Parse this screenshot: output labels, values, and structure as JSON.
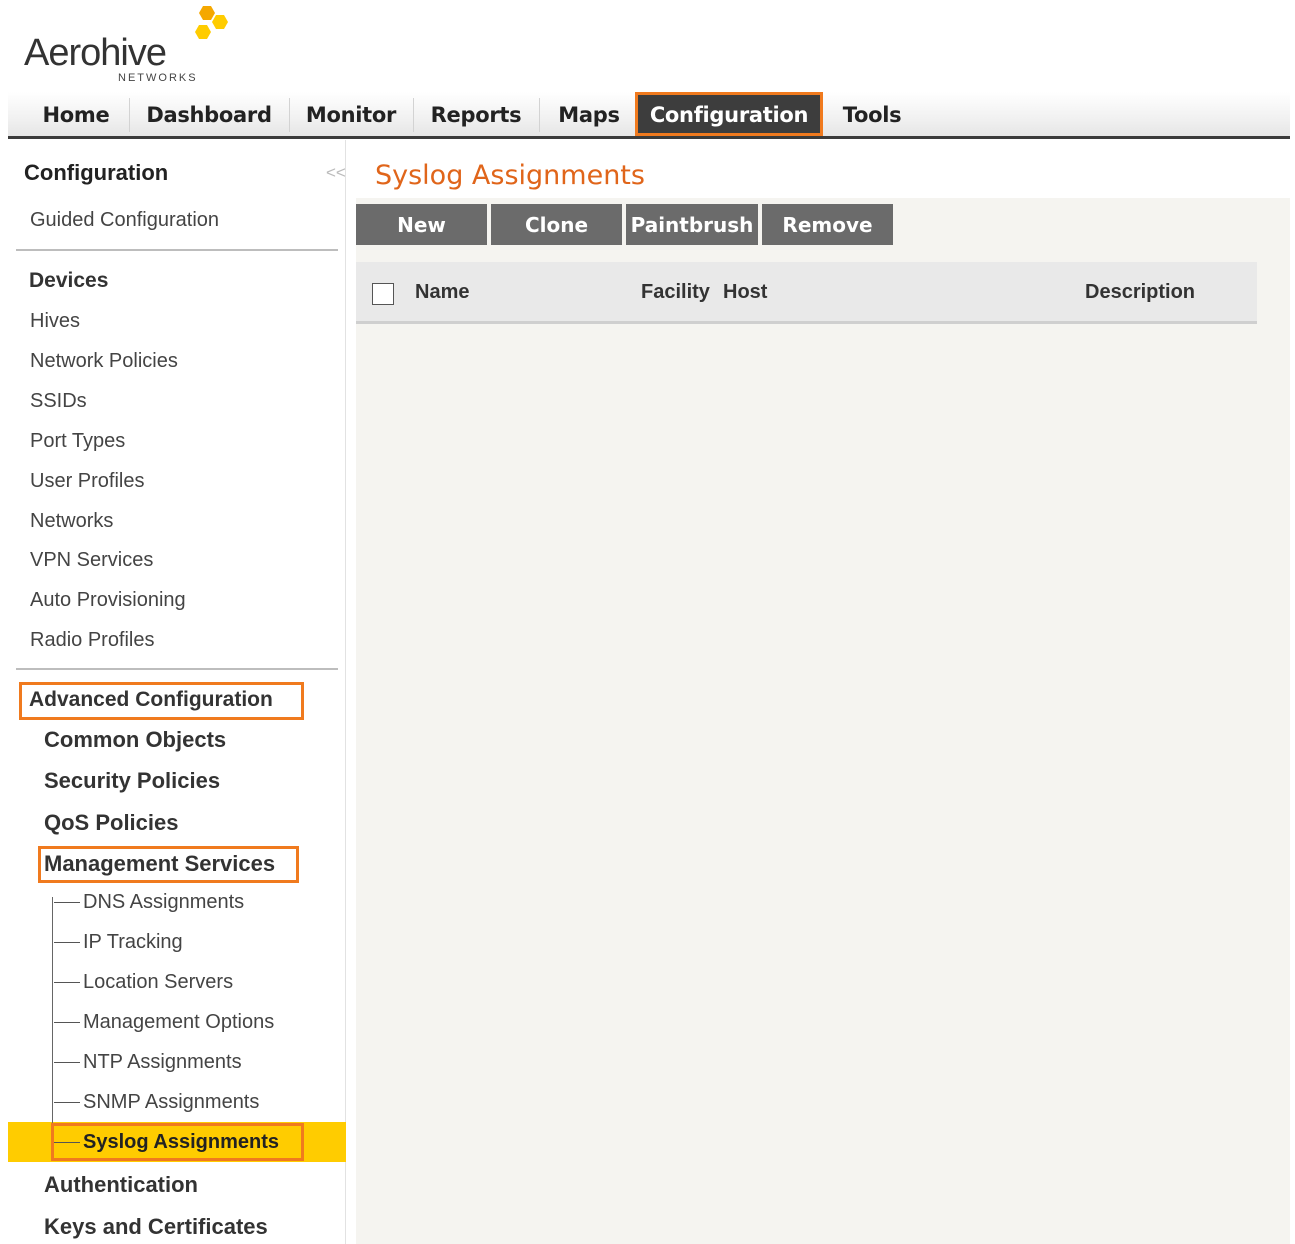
{
  "logo": {
    "wordmark": "Aerohive",
    "subtext": "NETWORKS",
    "colors": [
      "#f5a800",
      "#ffcc00"
    ]
  },
  "topnav": {
    "items": [
      "Home",
      "Dashboard",
      "Monitor",
      "Reports",
      "Maps",
      "Configuration",
      "Tools"
    ],
    "active": "Configuration"
  },
  "sidebar": {
    "title": "Configuration",
    "collapse_glyph": "<<",
    "guided": "Guided Configuration",
    "devices_heading": "Devices",
    "device_links": [
      "Hives",
      "Network Policies",
      "SSIDs",
      "Port Types",
      "User Profiles",
      "Networks",
      "VPN Services",
      "Auto Provisioning",
      "Radio Profiles"
    ],
    "advanced_heading": "Advanced Configuration",
    "advanced_sections": [
      "Common Objects",
      "Security Policies",
      "QoS Policies",
      "Management Services"
    ],
    "management_items": [
      "DNS Assignments",
      "IP Tracking",
      "Location Servers",
      "Management Options",
      "NTP Assignments",
      "SNMP Assignments",
      "Syslog Assignments"
    ],
    "selected": "Syslog Assignments",
    "after_sections": [
      "Authentication",
      "Keys and Certificates"
    ]
  },
  "main": {
    "title": "Syslog Assignments",
    "buttons": [
      "New",
      "Clone",
      "Paintbrush",
      "Remove"
    ],
    "columns": [
      "Name",
      "Facility",
      "Host",
      "Description"
    ]
  },
  "colors": {
    "accent_orange": "#f07a1e",
    "title_orange": "#e0651a",
    "selected_yellow": "#ffcc00",
    "active_tab": "#3d3d3d",
    "button_gray": "#6b6b6b"
  }
}
